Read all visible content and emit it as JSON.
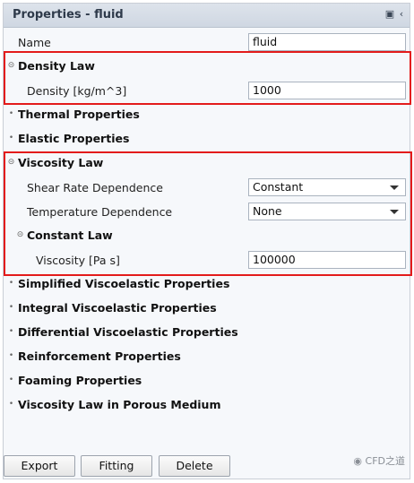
{
  "window": {
    "title": "Properties - fluid"
  },
  "name_row": {
    "label": "Name",
    "value": "fluid"
  },
  "density_law": {
    "header": "Density Law",
    "density_label": "Density [kg/m^3]",
    "density_value": "1000"
  },
  "collapsed_top": [
    "Thermal Properties",
    "Elastic Properties"
  ],
  "viscosity_law": {
    "header": "Viscosity Law",
    "shear_label": "Shear Rate Dependence",
    "shear_value": "Constant",
    "temp_label": "Temperature Dependence",
    "temp_value": "None",
    "constant_law_header": "Constant Law",
    "viscosity_label": "Viscosity [Pa s]",
    "viscosity_value": "100000"
  },
  "collapsed_bottom": [
    "Simplified Viscoelastic Properties",
    "Integral Viscoelastic Properties",
    "Differential Viscoelastic Properties",
    "Reinforcement Properties",
    "Foaming Properties",
    "Viscosity Law in Porous Medium"
  ],
  "buttons": {
    "export": "Export",
    "fitting": "Fitting",
    "delete": "Delete"
  },
  "watermark": "CFD之道",
  "colors": {
    "highlight": "#e31b1b",
    "titlebar": "#d4dbe5"
  },
  "icons": [
    "pin-icon",
    "chevron-left-icon",
    "collapse-icon",
    "expand-icon",
    "dropdown-arrow-icon",
    "wechat-icon"
  ]
}
